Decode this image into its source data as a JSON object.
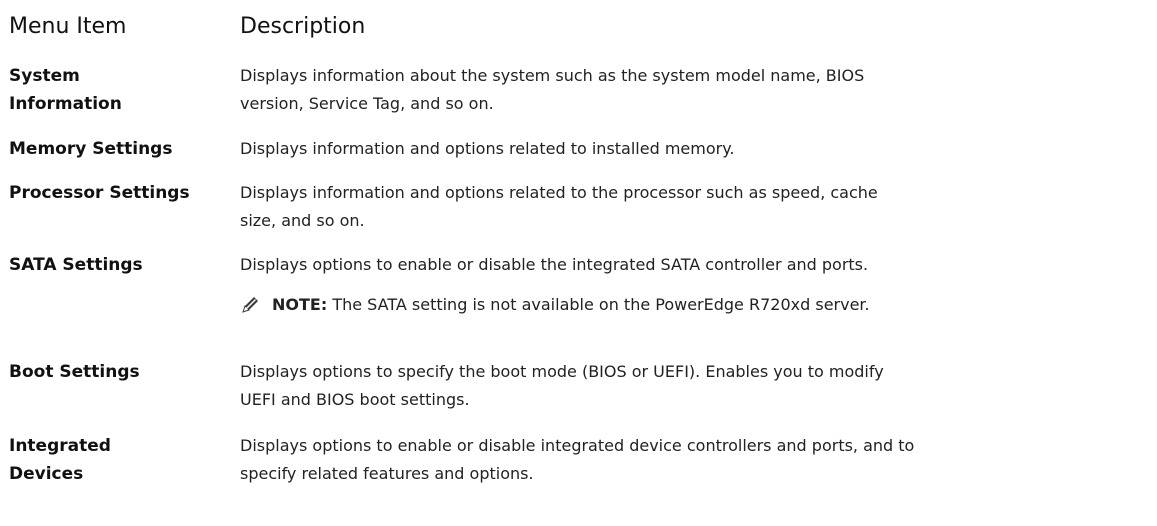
{
  "header": {
    "col_term": "Menu Item",
    "col_desc": "Description"
  },
  "items": [
    {
      "term_line1": "System",
      "term_line2": "Information",
      "desc_line1": "Displays information about the system such as the system model name, BIOS",
      "desc_line2": "version, Service Tag, and so on."
    },
    {
      "term_line1": "Memory Settings",
      "desc_line1": "Displays information and options related to installed memory."
    },
    {
      "term_line1": "Processor Settings",
      "desc_line1": "Displays information and options related to the processor such as speed, cache",
      "desc_line2": "size, and so on."
    },
    {
      "term_line1": "SATA Settings",
      "desc_line1": "Displays options to enable or disable the integrated SATA controller and ports.",
      "note_label": "NOTE:",
      "note_text": " The SATA setting is not available on the PowerEdge R720xd server."
    },
    {
      "term_line1": "Boot Settings",
      "desc_line1": "Displays options to specify the boot mode (BIOS or UEFI). Enables you to modify",
      "desc_line2": "UEFI and BIOS boot settings."
    },
    {
      "term_line1": "Integrated",
      "term_line2": "Devices",
      "desc_line1": "Displays options to enable or disable integrated device controllers and ports, and to",
      "desc_line2": "specify related features and options."
    }
  ]
}
